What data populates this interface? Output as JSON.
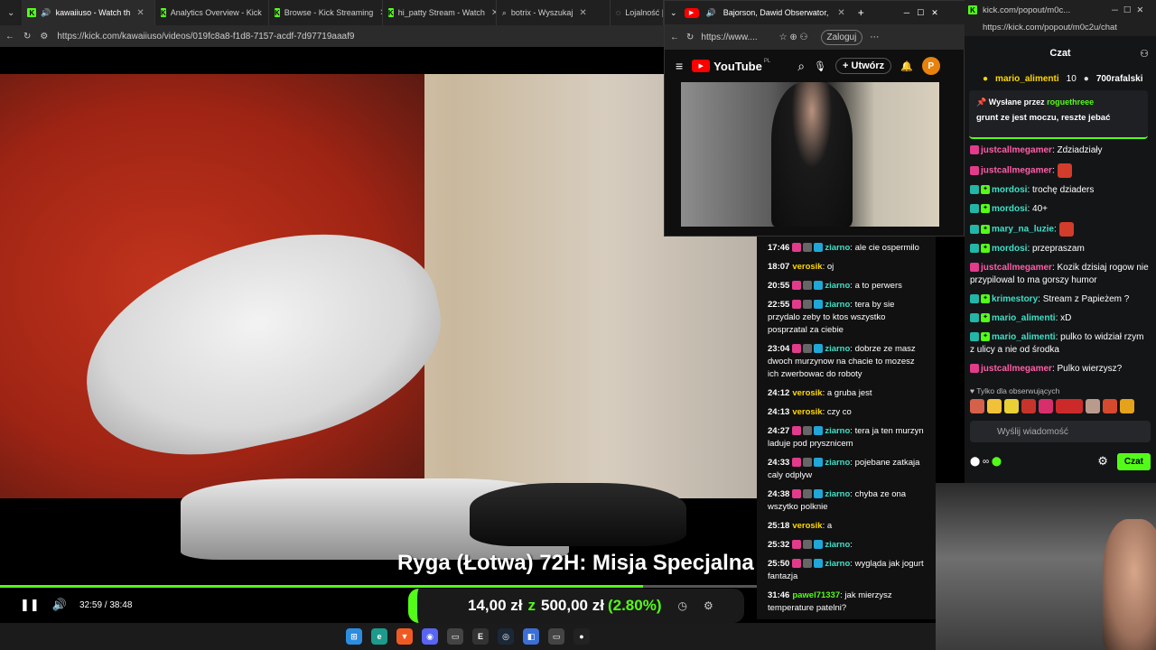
{
  "main_browser": {
    "tabs": [
      {
        "label": "kawaiiuso - Watch th",
        "active": true
      },
      {
        "label": "Analytics Overview - Kick",
        "active": false
      },
      {
        "label": "Browse - Kick Streaming",
        "active": false
      },
      {
        "label": "hi_patty Stream - Watch",
        "active": false
      },
      {
        "label": "botrix - Wyszukaj",
        "active": false
      },
      {
        "label": "Lojalność | N",
        "active": false
      }
    ],
    "url": "https://kick.com/kawaiiuso/videos/019fc8a8-f1d8-7157-acdf-7d97719aaaf9"
  },
  "video": {
    "overlay_title": "Ryga (Łotwa) 72H: Misja Specjalna",
    "time_current": "32:59",
    "time_separator": "/",
    "time_total": "38:48",
    "progress_fraction": 0.85,
    "donation": {
      "current": "14,00 zł",
      "sep": "z",
      "goal": "500,00 zł",
      "percent": "(2.80%)"
    }
  },
  "vod_chat": [
    {
      "time": "17:46",
      "user": "ziarno",
      "color": "teal",
      "text": "ale cie ospermilo"
    },
    {
      "time": "18:07",
      "user": "verosik",
      "color": "gold",
      "text": "oj"
    },
    {
      "time": "20:55",
      "user": "ziarno",
      "color": "teal",
      "text": "a to perwers"
    },
    {
      "time": "22:55",
      "user": "ziarno",
      "color": "teal",
      "text": "tera by sie przydalo zeby to ktos wszystko posprzatal za ciebie"
    },
    {
      "time": "23:04",
      "user": "ziarno",
      "color": "teal",
      "text": "dobrze ze masz dwoch murzynow na chacie to mozesz ich zwerbowac do roboty"
    },
    {
      "time": "24:12",
      "user": "verosik",
      "color": "gold",
      "text": "a gruba jest"
    },
    {
      "time": "24:13",
      "user": "verosik",
      "color": "gold",
      "text": "czy co"
    },
    {
      "time": "24:27",
      "user": "ziarno",
      "color": "teal",
      "text": "tera ja ten murzyn laduje pod prysznicem"
    },
    {
      "time": "24:33",
      "user": "ziarno",
      "color": "teal",
      "text": "pojebane zatkaja caly odplyw"
    },
    {
      "time": "24:38",
      "user": "ziarno",
      "color": "teal",
      "text": "chyba ze ona wszytko polknie"
    },
    {
      "time": "25:18",
      "user": "verosik",
      "color": "gold",
      "text": "a"
    },
    {
      "time": "25:32",
      "user": "ziarno",
      "color": "teal",
      "text": ""
    },
    {
      "time": "25:50",
      "user": "ziarno",
      "color": "teal",
      "text": "wygląda jak jogurt fantazja"
    },
    {
      "time": "31:46",
      "user": "pawel71337",
      "color": "green",
      "text": "jak mierzysz temperature patelni?"
    }
  ],
  "youtube": {
    "tab_label": "Bajorson, Dawid Obserwator,",
    "url": "https://www....",
    "login_label": "Zaloguj",
    "logo_text": "YouTube",
    "country": "PL",
    "create_label": "Utwórz",
    "avatar_letter": "P"
  },
  "popout": {
    "url_tab": "kick.com/popout/m0c...",
    "url": "https://kick.com/popout/m0c2u/chat",
    "header": "Czat",
    "top_gifters": [
      {
        "name": "mario_alimenti",
        "count": "10"
      },
      {
        "name": "700rafalski",
        "count": ""
      }
    ],
    "pinned": {
      "label": "Wysłane przez",
      "user": "roguethreee",
      "text": "grunt ze jest moczu, reszte jebać"
    },
    "messages": [
      {
        "user": "justcallmegamer",
        "color": "pink",
        "text": "Zdziadziały"
      },
      {
        "user": "justcallmegamer",
        "color": "pink",
        "text": ""
      },
      {
        "user": "mordosi",
        "color": "teal",
        "text": "trochę dziaders"
      },
      {
        "user": "mordosi",
        "color": "teal",
        "text": "40+"
      },
      {
        "user": "mary_na_luzie",
        "color": "teal",
        "text": ""
      },
      {
        "user": "mordosi",
        "color": "teal",
        "text": "przepraszam"
      },
      {
        "user": "justcallmegamer",
        "color": "pink",
        "text": "Kozik dzisiaj rogow nie przypilowal to ma gorszy humor"
      },
      {
        "user": "krimestory",
        "color": "teal",
        "text": "Stream z Papieżem ?"
      },
      {
        "user": "mario_alimenti",
        "color": "teal",
        "text": "xD"
      },
      {
        "user": "mario_alimenti",
        "color": "teal",
        "text": "pulko to widział rzym z ulicy a nie od środka"
      },
      {
        "user": "justcallmegamer",
        "color": "pink",
        "text": "Pulko wierzysz?"
      }
    ],
    "followers_only": "Tylko dla obserwujących",
    "send_placeholder": "Wyślij wiadomość",
    "chat_button": "Czat"
  },
  "colors": {
    "kick_green": "#53fc18",
    "teal": "#3ee0c8",
    "gold": "#ffd700",
    "pink": "#ff5fa8"
  }
}
